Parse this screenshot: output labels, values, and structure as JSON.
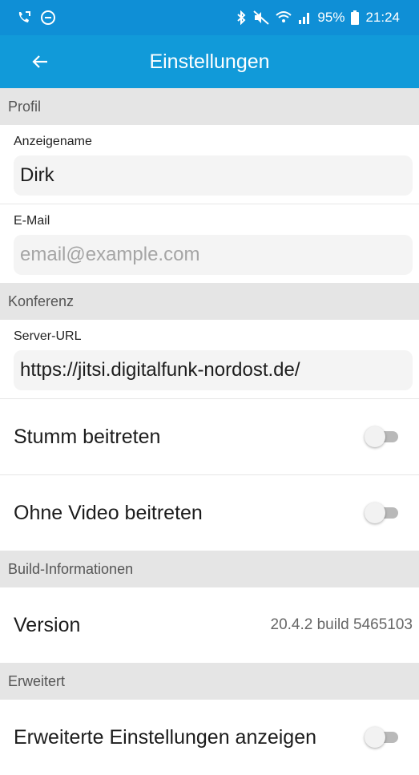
{
  "status_bar": {
    "battery_percent": "95%",
    "time": "21:24",
    "icons": [
      "call-forward-icon",
      "minus-circle-icon",
      "bluetooth-icon",
      "mute-icon",
      "wifi-icon",
      "signal-icon",
      "battery-icon"
    ]
  },
  "app_bar": {
    "title": "Einstellungen",
    "back_icon": "arrow-left-icon"
  },
  "sections": {
    "profile": "Profil",
    "conference": "Konferenz",
    "build": "Build-Informationen",
    "advanced": "Erweitert"
  },
  "fields": {
    "display_name": {
      "label": "Anzeigename",
      "value": "Dirk"
    },
    "email": {
      "label": "E-Mail",
      "placeholder": "email@example.com",
      "value": ""
    },
    "server_url": {
      "label": "Server-URL",
      "value": "https://jitsi.digitalfunk-nordost.de/"
    }
  },
  "toggles": {
    "start_muted": {
      "label": "Stumm beitreten",
      "on": false
    },
    "start_without_video": {
      "label": "Ohne Video beitreten",
      "on": false
    },
    "show_advanced": {
      "label": "Erweiterte Einstellungen anzeigen",
      "on": false
    }
  },
  "build_info": {
    "label": "Version",
    "value": "20.4.2 build 5465103"
  },
  "colors": {
    "accent": "#119ad9",
    "statusbar": "#0f8fd6",
    "section_bg": "#e5e5e5"
  }
}
